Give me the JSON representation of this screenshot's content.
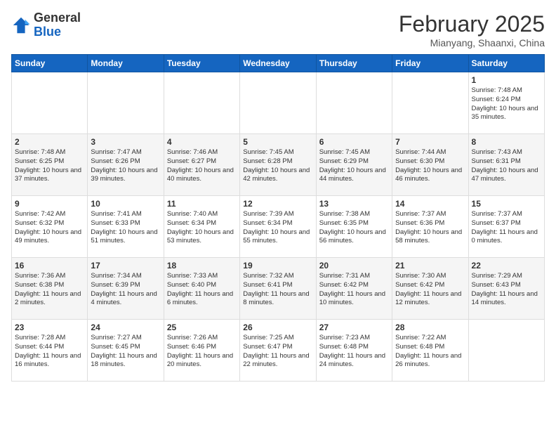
{
  "header": {
    "logo": {
      "general": "General",
      "blue": "Blue"
    },
    "title": "February 2025",
    "subtitle": "Mianyang, Shaanxi, China"
  },
  "weekdays": [
    "Sunday",
    "Monday",
    "Tuesday",
    "Wednesday",
    "Thursday",
    "Friday",
    "Saturday"
  ],
  "weeks": [
    [
      {
        "day": "",
        "sunrise": "",
        "sunset": "",
        "daylight": ""
      },
      {
        "day": "",
        "sunrise": "",
        "sunset": "",
        "daylight": ""
      },
      {
        "day": "",
        "sunrise": "",
        "sunset": "",
        "daylight": ""
      },
      {
        "day": "",
        "sunrise": "",
        "sunset": "",
        "daylight": ""
      },
      {
        "day": "",
        "sunrise": "",
        "sunset": "",
        "daylight": ""
      },
      {
        "day": "",
        "sunrise": "",
        "sunset": "",
        "daylight": ""
      },
      {
        "day": "1",
        "sunrise": "Sunrise: 7:48 AM",
        "sunset": "Sunset: 6:24 PM",
        "daylight": "Daylight: 10 hours and 35 minutes."
      }
    ],
    [
      {
        "day": "2",
        "sunrise": "Sunrise: 7:48 AM",
        "sunset": "Sunset: 6:25 PM",
        "daylight": "Daylight: 10 hours and 37 minutes."
      },
      {
        "day": "3",
        "sunrise": "Sunrise: 7:47 AM",
        "sunset": "Sunset: 6:26 PM",
        "daylight": "Daylight: 10 hours and 39 minutes."
      },
      {
        "day": "4",
        "sunrise": "Sunrise: 7:46 AM",
        "sunset": "Sunset: 6:27 PM",
        "daylight": "Daylight: 10 hours and 40 minutes."
      },
      {
        "day": "5",
        "sunrise": "Sunrise: 7:45 AM",
        "sunset": "Sunset: 6:28 PM",
        "daylight": "Daylight: 10 hours and 42 minutes."
      },
      {
        "day": "6",
        "sunrise": "Sunrise: 7:45 AM",
        "sunset": "Sunset: 6:29 PM",
        "daylight": "Daylight: 10 hours and 44 minutes."
      },
      {
        "day": "7",
        "sunrise": "Sunrise: 7:44 AM",
        "sunset": "Sunset: 6:30 PM",
        "daylight": "Daylight: 10 hours and 46 minutes."
      },
      {
        "day": "8",
        "sunrise": "Sunrise: 7:43 AM",
        "sunset": "Sunset: 6:31 PM",
        "daylight": "Daylight: 10 hours and 47 minutes."
      }
    ],
    [
      {
        "day": "9",
        "sunrise": "Sunrise: 7:42 AM",
        "sunset": "Sunset: 6:32 PM",
        "daylight": "Daylight: 10 hours and 49 minutes."
      },
      {
        "day": "10",
        "sunrise": "Sunrise: 7:41 AM",
        "sunset": "Sunset: 6:33 PM",
        "daylight": "Daylight: 10 hours and 51 minutes."
      },
      {
        "day": "11",
        "sunrise": "Sunrise: 7:40 AM",
        "sunset": "Sunset: 6:34 PM",
        "daylight": "Daylight: 10 hours and 53 minutes."
      },
      {
        "day": "12",
        "sunrise": "Sunrise: 7:39 AM",
        "sunset": "Sunset: 6:34 PM",
        "daylight": "Daylight: 10 hours and 55 minutes."
      },
      {
        "day": "13",
        "sunrise": "Sunrise: 7:38 AM",
        "sunset": "Sunset: 6:35 PM",
        "daylight": "Daylight: 10 hours and 56 minutes."
      },
      {
        "day": "14",
        "sunrise": "Sunrise: 7:37 AM",
        "sunset": "Sunset: 6:36 PM",
        "daylight": "Daylight: 10 hours and 58 minutes."
      },
      {
        "day": "15",
        "sunrise": "Sunrise: 7:37 AM",
        "sunset": "Sunset: 6:37 PM",
        "daylight": "Daylight: 11 hours and 0 minutes."
      }
    ],
    [
      {
        "day": "16",
        "sunrise": "Sunrise: 7:36 AM",
        "sunset": "Sunset: 6:38 PM",
        "daylight": "Daylight: 11 hours and 2 minutes."
      },
      {
        "day": "17",
        "sunrise": "Sunrise: 7:34 AM",
        "sunset": "Sunset: 6:39 PM",
        "daylight": "Daylight: 11 hours and 4 minutes."
      },
      {
        "day": "18",
        "sunrise": "Sunrise: 7:33 AM",
        "sunset": "Sunset: 6:40 PM",
        "daylight": "Daylight: 11 hours and 6 minutes."
      },
      {
        "day": "19",
        "sunrise": "Sunrise: 7:32 AM",
        "sunset": "Sunset: 6:41 PM",
        "daylight": "Daylight: 11 hours and 8 minutes."
      },
      {
        "day": "20",
        "sunrise": "Sunrise: 7:31 AM",
        "sunset": "Sunset: 6:42 PM",
        "daylight": "Daylight: 11 hours and 10 minutes."
      },
      {
        "day": "21",
        "sunrise": "Sunrise: 7:30 AM",
        "sunset": "Sunset: 6:42 PM",
        "daylight": "Daylight: 11 hours and 12 minutes."
      },
      {
        "day": "22",
        "sunrise": "Sunrise: 7:29 AM",
        "sunset": "Sunset: 6:43 PM",
        "daylight": "Daylight: 11 hours and 14 minutes."
      }
    ],
    [
      {
        "day": "23",
        "sunrise": "Sunrise: 7:28 AM",
        "sunset": "Sunset: 6:44 PM",
        "daylight": "Daylight: 11 hours and 16 minutes."
      },
      {
        "day": "24",
        "sunrise": "Sunrise: 7:27 AM",
        "sunset": "Sunset: 6:45 PM",
        "daylight": "Daylight: 11 hours and 18 minutes."
      },
      {
        "day": "25",
        "sunrise": "Sunrise: 7:26 AM",
        "sunset": "Sunset: 6:46 PM",
        "daylight": "Daylight: 11 hours and 20 minutes."
      },
      {
        "day": "26",
        "sunrise": "Sunrise: 7:25 AM",
        "sunset": "Sunset: 6:47 PM",
        "daylight": "Daylight: 11 hours and 22 minutes."
      },
      {
        "day": "27",
        "sunrise": "Sunrise: 7:23 AM",
        "sunset": "Sunset: 6:48 PM",
        "daylight": "Daylight: 11 hours and 24 minutes."
      },
      {
        "day": "28",
        "sunrise": "Sunrise: 7:22 AM",
        "sunset": "Sunset: 6:48 PM",
        "daylight": "Daylight: 11 hours and 26 minutes."
      },
      {
        "day": "",
        "sunrise": "",
        "sunset": "",
        "daylight": ""
      }
    ]
  ]
}
